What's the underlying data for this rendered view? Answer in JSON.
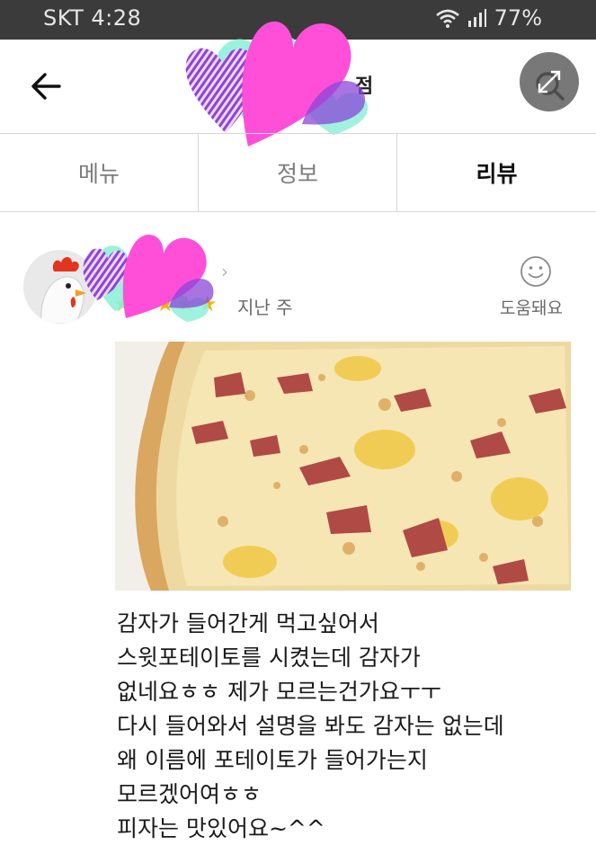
{
  "status_bar": {
    "carrier_time": "SKT 4:28",
    "battery": "77%",
    "icons": [
      "wifi-icon",
      "signal-icon",
      "battery-icon"
    ]
  },
  "header": {
    "title_visible": "점",
    "back_icon": "arrow-left-icon",
    "search_icon": "search-icon",
    "expand_icon": "expand-icon"
  },
  "tabs": [
    {
      "label": "메뉴",
      "active": false
    },
    {
      "label": "정보",
      "active": false
    },
    {
      "label": "리뷰",
      "active": true
    }
  ],
  "review": {
    "rating": 5,
    "date": "지난 주",
    "helpful_label": "도움돼요",
    "lines": [
      "감자가 들어간게 먹고싶어서",
      "스윗포테이토를 시켰는데 감자가",
      "없네요ㅎㅎ 제가 모르는건가요ㅜㅜ",
      "다시 들어와서 설명을 봐도 감자는 없는데",
      "왜 이름에 포테이토가 들어가는지",
      "모르겠어여ㅎㅎ",
      "피자는 맛있어요~^^"
    ]
  },
  "colors": {
    "status_bar": "#3b3b3b",
    "star": "#f5b400",
    "sticker_pink": "#ff4fd8",
    "sticker_mint": "#8ff0d8",
    "sticker_purple": "#8a46d8"
  }
}
